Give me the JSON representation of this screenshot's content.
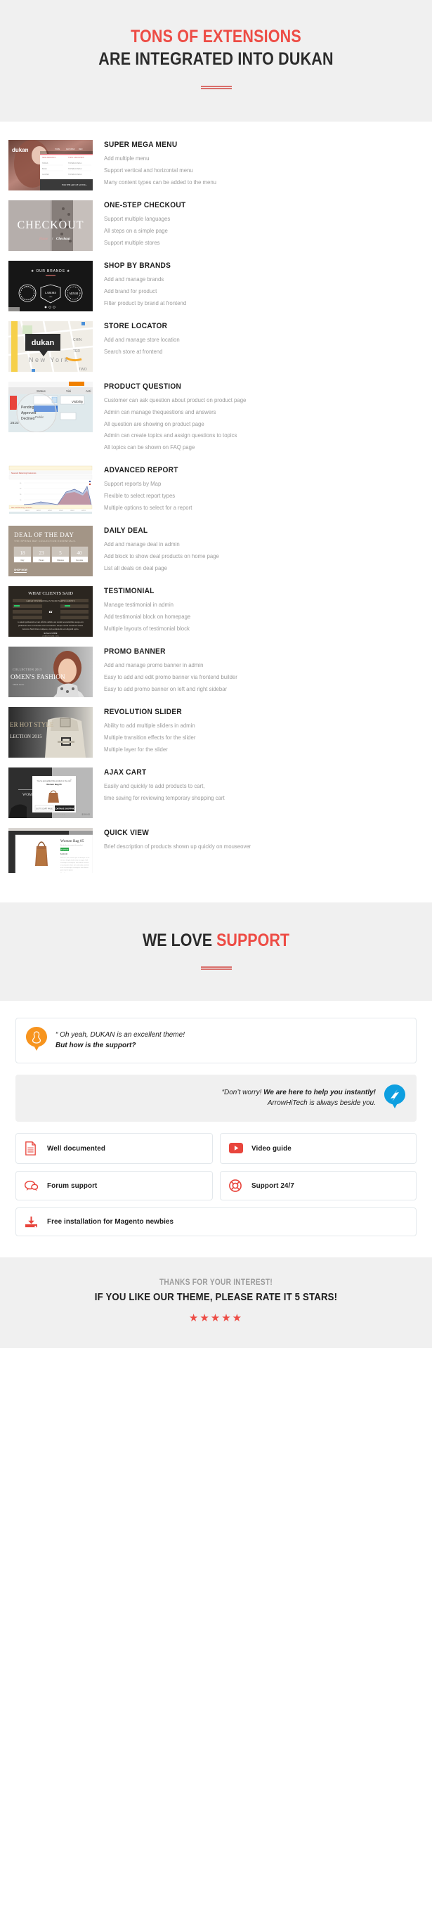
{
  "hero": {
    "line1": "TONS OF EXTENSIONS",
    "line2": "ARE INTEGRATED INTO DUKAN",
    "accent_color": "#ed4c45",
    "divider_color": "#d9706c"
  },
  "features": [
    {
      "title": "SUPER MEGA MENU",
      "lines": [
        "Add multiple menu",
        "Support vertical and horizontal menu",
        "Many content types can be added to the menu"
      ],
      "thumb": "mega-menu-screenshot"
    },
    {
      "title": "ONE-STEP CHECKOUT",
      "lines": [
        "Support multiple languages",
        "All steps on a simple page",
        "Support multiple stores"
      ],
      "thumb": "checkout-banner",
      "thumb_text": "CHECKOUT",
      "thumb_crumb": "Home  /  Checkout"
    },
    {
      "title": "SHOP BY BRANDS",
      "lines": [
        "Add and manage brands",
        "Add brand for product",
        "Filter product by brand at frontend"
      ],
      "thumb": "our-brands-dark",
      "thumb_text": "OUR BRANDS",
      "brand_labels": [
        "TEMPOR INCIDIDUNT",
        "LABORE",
        "MINIM"
      ]
    },
    {
      "title": "STORE LOCATOR",
      "lines": [
        "Add and manage store location",
        "Search store at frontend"
      ],
      "thumb": "map-new-york",
      "thumb_text": "dukan",
      "thumb_city": "New York"
    },
    {
      "title": "PRODUCT QUESTION",
      "lines": [
        "Customer can ask question about product on product page",
        "Admin can manage thequestions and answers",
        "All question are showing on product page",
        "Admin can create topics and assign questions to topics",
        "All topics can be shown on FAQ page"
      ],
      "thumb": "admin-grid-magnifier",
      "thumb_labels": [
        "Status",
        "Visibility",
        "Action",
        "Pending",
        "Approved",
        "Declined",
        "Public"
      ]
    },
    {
      "title": "ADVANCED REPORT",
      "lines": [
        "Support reports by Map",
        "Flexible to select report types",
        "Multiple options to select for a report"
      ],
      "thumb": "report-area-chart"
    },
    {
      "title": "DAILY DEAL",
      "lines": [
        "Add and manage deal in admin",
        "Add block to show deal products on home page",
        "List all deals on deal page"
      ],
      "thumb": "deal-of-the-day",
      "thumb_text": "DEAL OF THE DAY",
      "thumb_sub": "THE SPRING BAY COLLECTION ESSENTIALS.",
      "countdown": [
        {
          "value": "18",
          "label": "Day"
        },
        {
          "value": "23",
          "label": "Hours"
        },
        {
          "value": "5",
          "label": "Minutes"
        },
        {
          "value": "40",
          "label": "Seconds"
        }
      ],
      "thumb_cta": "SHOP NOW"
    },
    {
      "title": "TESTIMONIAL",
      "lines": [
        "Manage testimonial in admin",
        "Add testimonial block on homepage",
        "Multiple layouts of testimonial block"
      ],
      "thumb": "what-clients-said",
      "thumb_text": "WHAT CLIENTS SAID",
      "thumb_sub": "GREAT TESTIMONIALS FROM HAPPY CLIENTS",
      "thumb_author": "ROSA LECHER"
    },
    {
      "title": "PROMO BANNER",
      "lines": [
        "Add and manage promo banner in admin",
        "Easy to add and edit promo banner via frontend builder",
        "Easy to add promo banner on left and right sidebar"
      ],
      "thumb": "promo-banner-fashion",
      "thumb_text": "COLLECTION 2015",
      "thumb_sub": "WOMEN'S FASHION"
    },
    {
      "title": "REVOLUTION SLIDER",
      "lines": [
        "Ability to add multiple sliders in admin",
        "Multiple transition effects for the slider",
        "Multiple layer for the slider"
      ],
      "thumb": "revolution-slider-bag",
      "thumb_text": "ER HOT STYLE",
      "thumb_sub": "LECTION 2015"
    },
    {
      "title": "AJAX CART",
      "lines": [
        "Easily and quickly to add products to cart,",
        "time saving for reviewing temporary shopping cart"
      ],
      "thumb": "ajax-cart-popup",
      "thumb_text": "You've just added this product to the cart:",
      "thumb_product": "Women Bag 05",
      "thumb_buttons": [
        "GO TO CART PAGE",
        "CONTINUE SHOPPING"
      ]
    },
    {
      "title": "QUICK VIEW",
      "lines": [
        "Brief description of products shown up quickly on mouseover"
      ],
      "thumb": "quick-view-modal",
      "thumb_product": "Women Bag 05",
      "thumb_stock": "IN STOCK",
      "thumb_price": "$100.00"
    }
  ],
  "support": {
    "heading_plain": "WE LOVE ",
    "heading_accent": "SUPPORT",
    "question": {
      "line1": "“ Oh yeah, DUKAN is an excellent theme!",
      "line2": "But how is the support?",
      "icon_color": "#f7941e"
    },
    "reply": {
      "lead": "“Don’t worry! ",
      "bold": "We are here to help you instantly!",
      "line2": "ArrowHiTech is always beside you.",
      "icon_color": "#0e9fe0"
    },
    "tiles": [
      {
        "label": "Well documented",
        "icon": "document-icon"
      },
      {
        "label": "Video guide",
        "icon": "video-play-icon"
      },
      {
        "label": "Forum support",
        "icon": "chat-bubbles-icon"
      },
      {
        "label": "Support 24/7",
        "icon": "lifebuoy-icon"
      },
      {
        "label": "Free installation for Magento newbies",
        "icon": "download-icon"
      }
    ]
  },
  "footer": {
    "thanks": "THANKS FOR YOUR INTEREST!",
    "rate": "IF YOU LIKE OUR THEME, PLEASE RATE IT 5 STARS!",
    "stars": "★★★★★",
    "star_color": "#ed4c45"
  }
}
